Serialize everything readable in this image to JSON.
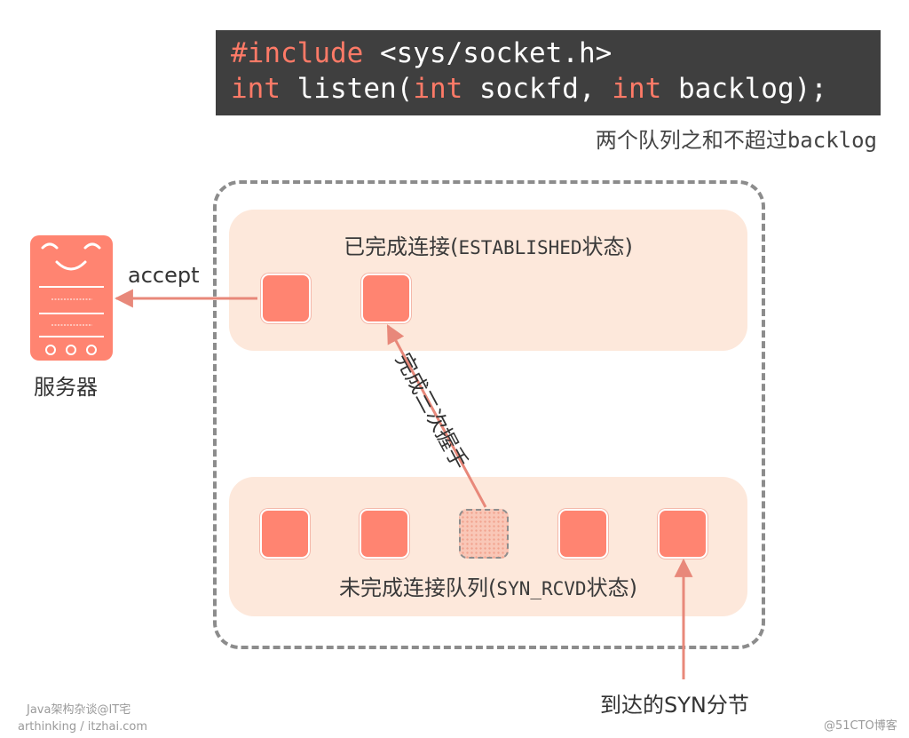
{
  "code": {
    "line1_kw": "#include",
    "line1_rest": " <sys/socket.h>",
    "line2_kw1": "int",
    "line2_part1": " listen(",
    "line2_kw2": "int",
    "line2_part2": " sockfd, ",
    "line2_kw3": "int",
    "line2_part3": " backlog);"
  },
  "note": {
    "prefix": "两个队列之和不超过",
    "mono": "backlog"
  },
  "established_queue": {
    "title_prefix": "已完成连接(",
    "title_mono": "ESTABLISHED",
    "title_suffix": "状态)",
    "items": 2
  },
  "syn_queue": {
    "title_prefix": "未完成连接队列(",
    "title_mono": "SYN_RCVD",
    "title_suffix": "状态)",
    "items": 5
  },
  "accept_label": "accept",
  "server_label": "服务器",
  "handshake_label": "完成三次握手",
  "syn_arrival_label": "到达的SYN分节",
  "watermarks": {
    "line1": "Java架构杂谈@IT宅",
    "line2": "arthinking / itzhai.com",
    "corner": "@51CTO博客"
  },
  "colors": {
    "accent": "#ff8471",
    "panel": "#fde8db",
    "code_bg": "#3f3f3f",
    "keyword": "#fe7a67",
    "arrow": "#e8887a"
  }
}
